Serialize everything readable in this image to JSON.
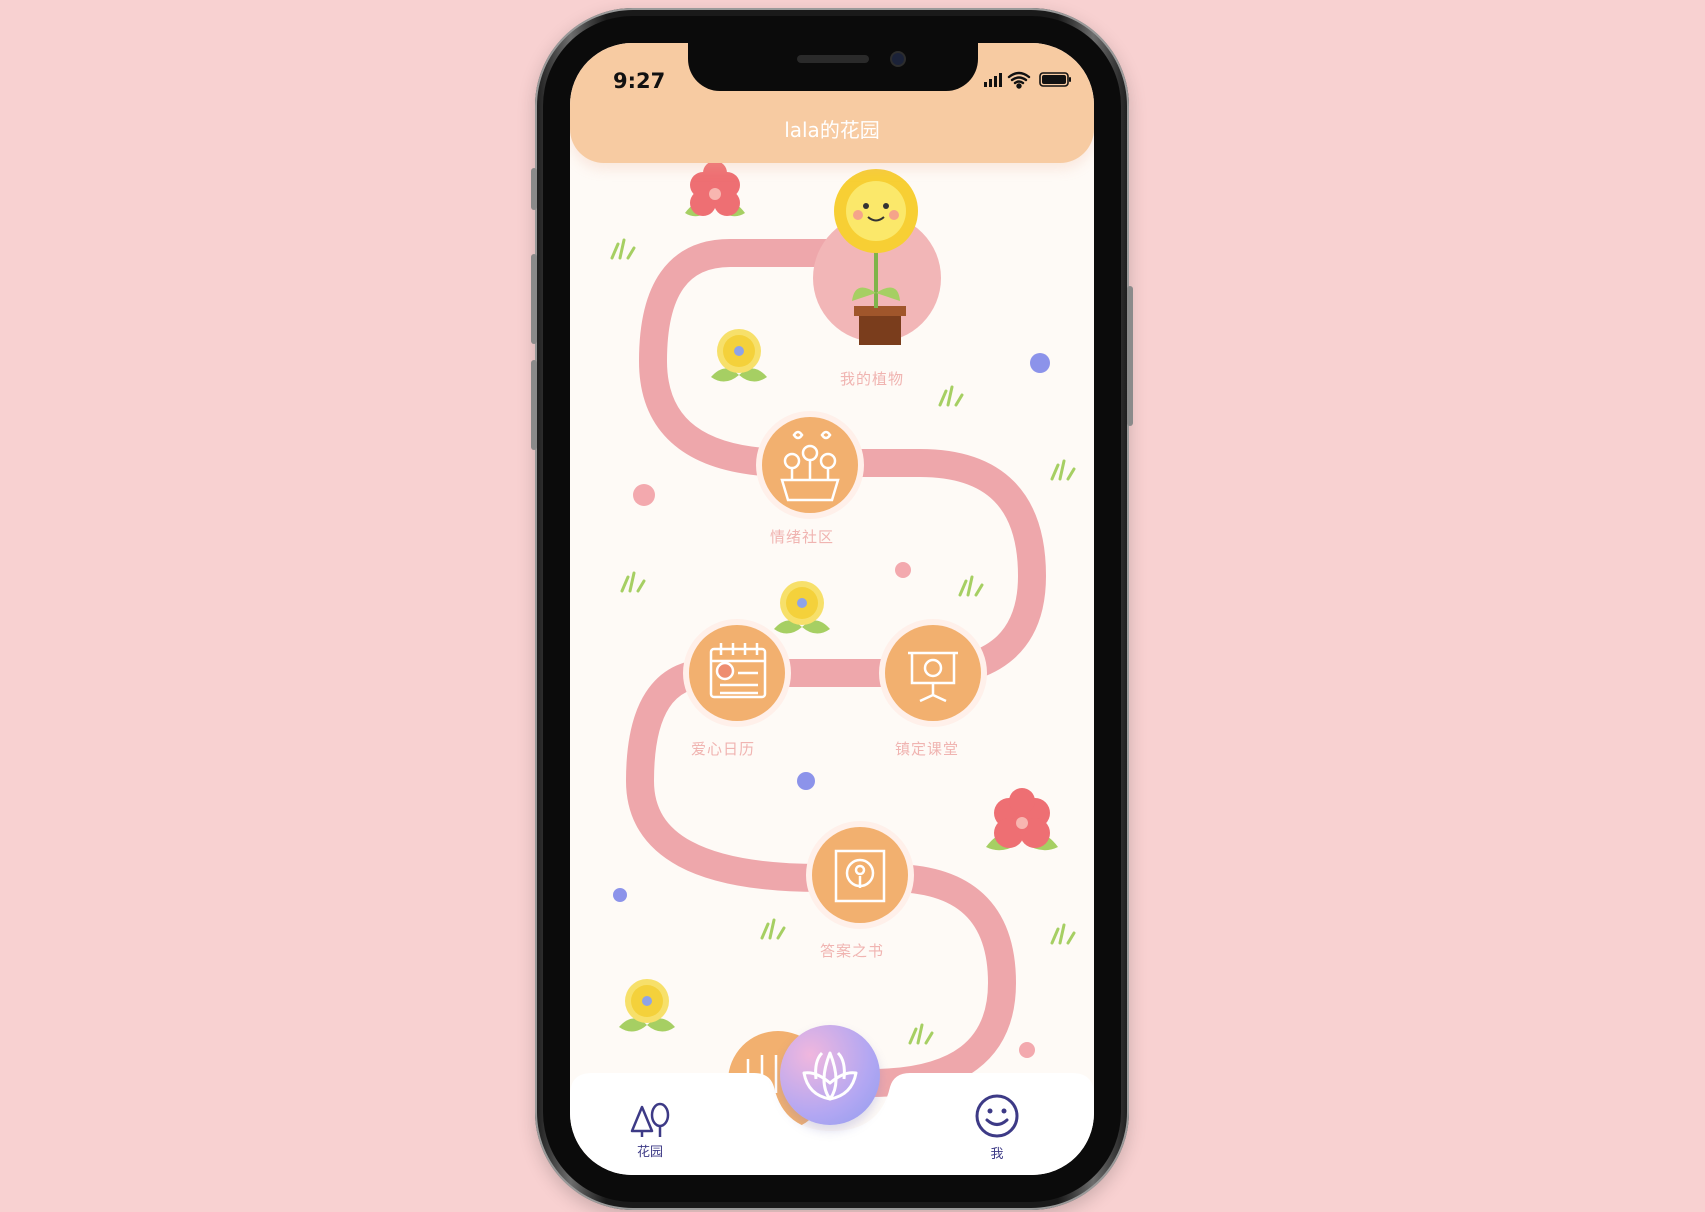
{
  "status_bar": {
    "time": "9:27"
  },
  "header": {
    "title": "lala的花园"
  },
  "nodes": [
    {
      "label": "我的植物",
      "icon": "sunflower-pot-icon"
    },
    {
      "label": "情绪社区",
      "icon": "flower-planter-icon"
    },
    {
      "label": "爱心日历",
      "icon": "calendar-icon"
    },
    {
      "label": "镇定课堂",
      "icon": "presentation-board-icon"
    },
    {
      "label": "答案之书",
      "icon": "flower-book-icon"
    }
  ],
  "tabbar": {
    "left": {
      "label": "花园",
      "icon": "trees-icon"
    },
    "center": {
      "icon": "lotus-icon"
    },
    "right": {
      "label": "我",
      "icon": "smiley-icon"
    }
  },
  "colors": {
    "background": "#f8d1d1",
    "header": "#f7cba2",
    "path": "#eea7ab",
    "node": "#f2b06f",
    "label": "#f0b4b1",
    "tab_icon": "#3d3a86"
  }
}
